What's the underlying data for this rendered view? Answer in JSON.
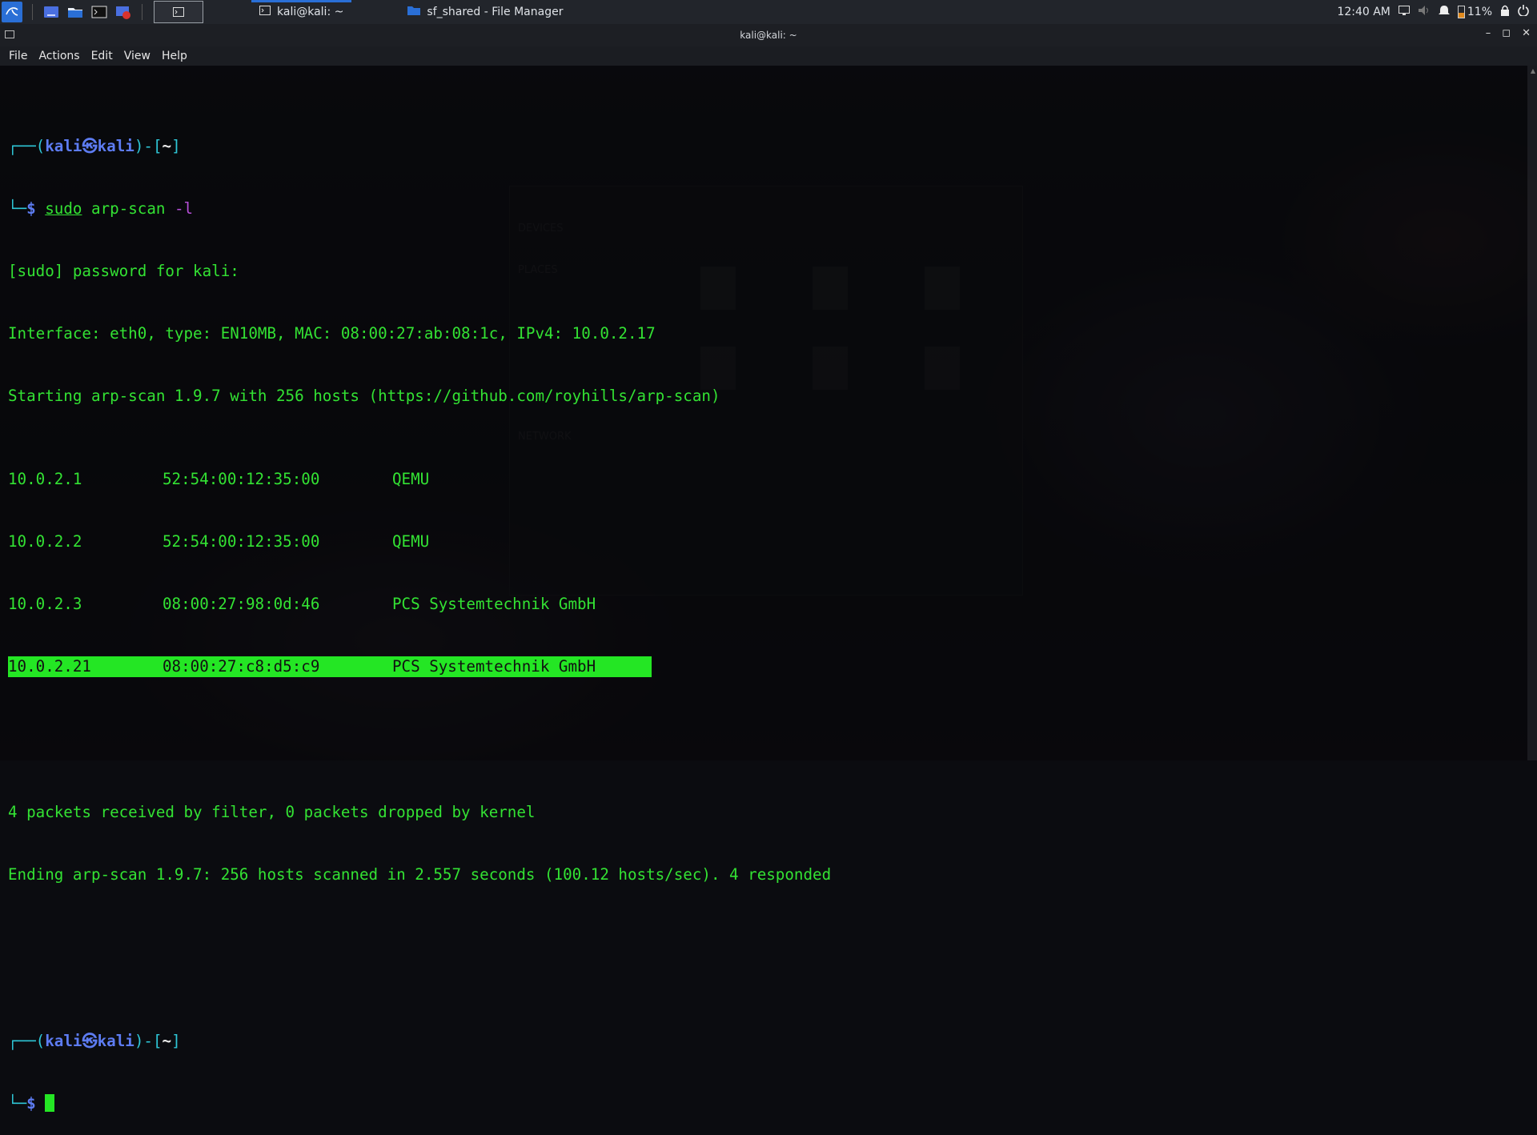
{
  "panel": {
    "tasks": [
      {
        "label": "kali@kali: ~",
        "active": true
      },
      {
        "label": "sf_shared - File Manager",
        "active": false
      }
    ],
    "clock": "12:40 AM",
    "battery": "11%"
  },
  "window": {
    "title": "kali@kali: ~",
    "menu": [
      "File",
      "Actions",
      "Edit",
      "View",
      "Help"
    ]
  },
  "terminal": {
    "prompt": {
      "top_left": "┌──(",
      "user": "kali",
      "at": "㉿",
      "host": "kali",
      "mid": ")-[",
      "cwd": "~",
      "end": "]",
      "bottom": "└─",
      "dollar": "$"
    },
    "command": {
      "sudo": "sudo",
      "rest": " arp-scan ",
      "flag": "-l"
    },
    "output": [
      "[sudo] password for kali:",
      "Interface: eth0, type: EN10MB, MAC: 08:00:27:ab:08:1c, IPv4: 10.0.2.17",
      "Starting arp-scan 1.9.7 with 256 hosts (https://github.com/royhills/arp-scan)"
    ],
    "hosts": [
      {
        "ip": "10.0.2.1",
        "mac": "52:54:00:12:35:00",
        "vendor": "QEMU"
      },
      {
        "ip": "10.0.2.2",
        "mac": "52:54:00:12:35:00",
        "vendor": "QEMU"
      },
      {
        "ip": "10.0.2.3",
        "mac": "08:00:27:98:0d:46",
        "vendor": "PCS Systemtechnik GmbH"
      },
      {
        "ip": "10.0.2.21",
        "mac": "08:00:27:c8:d5:c9",
        "vendor": "PCS Systemtechnik GmbH"
      }
    ],
    "summary": [
      "4 packets received by filter, 0 packets dropped by kernel",
      "Ending arp-scan 1.9.7: 256 hosts scanned in 2.557 seconds (100.12 hosts/sec). 4 responded"
    ]
  },
  "colors": {
    "terminal_text": "#33e233",
    "prompt_user": "#5d7cf2",
    "prompt_bracket": "#2ec7d7",
    "flag": "#b54ed7",
    "selection": "#24e624",
    "panel_bg": "#22252b",
    "accent": "#2a6fd6"
  }
}
